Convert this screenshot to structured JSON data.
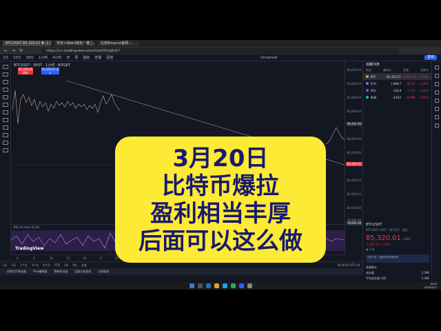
{
  "browser": {
    "tabs": [
      "BTCUSDT 85,320.01 ▼ -1.73% 無名",
      "币安+Web3钱包一键上...",
      "比安Binance官网-..."
    ],
    "url": "https://cn.tradingview.com/chart/lDnjdh0/?"
  },
  "toolbar": {
    "items": [
      "1分",
      "15分",
      "30分",
      "1小时",
      "4小时",
      "天",
      "周",
      "指标",
      "告警",
      "回放"
    ],
    "unnamed": "Unnamed",
    "publish": "发布"
  },
  "chart": {
    "symbol": "BTCUSDT · SPOT · 1小时 · BITGET",
    "sell_badge": "85,320.00 卖出",
    "buy_badge": "85,320.01 买入",
    "tv_logo": "TradingView",
    "yticks": [
      "96,000.00",
      "94,000.00",
      "92,000.00",
      "90,000.00",
      "88,000.00",
      "86,000.00",
      "84,000.00",
      "82,000.00",
      "80,000.00",
      "78,000.00"
    ],
    "ytag_high": "90,401.93",
    "ytag_price": "85,320.01",
    "ytag_low": "76,601.00",
    "xticks": [
      "4",
      "6",
      "10",
      "12",
      "14",
      "17",
      "19",
      "21",
      "24",
      "3月",
      "4",
      "6",
      "10",
      "12",
      "14",
      "17",
      "19",
      "2025-03-21",
      "4月"
    ],
    "rsi_label": "RSI 14 close",
    "rsi_value": "52.84"
  },
  "bottom": {
    "ranges": [
      "1天",
      "5天",
      "1个月",
      "3个月",
      "6个月",
      "YTD",
      "1年",
      "5年",
      "全部"
    ],
    "time": "16:40:07 UTC+8",
    "panel": [
      "加密货币筛选器",
      "Pine编辑器",
      "策略测试器",
      "回放交易面板",
      "交易面板"
    ]
  },
  "watchlist": {
    "title": "观察列表",
    "cols": [
      "商品",
      "最新价",
      "涨跌",
      "涨跌%"
    ],
    "rows": [
      {
        "sym": "BTC",
        "last": "85,320.01",
        "chg": "-1,501.13",
        "pct": "-1.73%",
        "up": false
      },
      {
        "sym": "ETH",
        "last": "1,998.7",
        "chg": "-44.05",
        "pct": "-2.16%",
        "up": false
      },
      {
        "sym": "SOL",
        "last": "130.8",
        "chg": "-4.52",
        "pct": "-3.34%",
        "up": false
      },
      {
        "sym": "BGB",
        "last": "4.632",
        "chg": "-0.098",
        "pct": "-2.07%",
        "up": false
      }
    ]
  },
  "detail": {
    "symbol": "BTCUSDT",
    "sub": "BTCUSDT SPOT · BITGET · 现货",
    "price": "85,320.01",
    "unit": "USDT",
    "change": "-1,501.13  -1.73%",
    "state": "● 开放",
    "note": "3月21日 · 加密货币市场分析",
    "stats_title": "关键统计",
    "stats": [
      {
        "label": "成交量",
        "value": "2.39K"
      },
      {
        "label": "平均成交量 (30)",
        "value": "5.38K"
      }
    ]
  },
  "taskbar": {
    "time": "16:45",
    "date": "2025/3/21"
  },
  "overlay": {
    "lines": [
      "3月20日",
      "比特币爆拉",
      "盈利相当丰厚",
      "后面可以这么做"
    ]
  },
  "colors": {
    "overlay_bg": "#fdea34",
    "overlay_text": "#1a1a6e",
    "down": "#f23645",
    "up": "#089981"
  }
}
